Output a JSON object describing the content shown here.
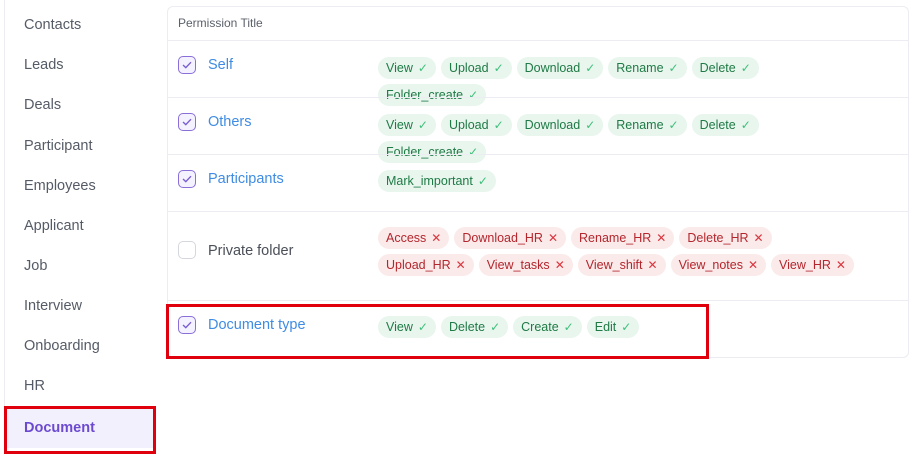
{
  "sidebar": {
    "items": [
      {
        "label": "Contacts"
      },
      {
        "label": "Leads"
      },
      {
        "label": "Deals"
      },
      {
        "label": "Participant"
      },
      {
        "label": "Employees"
      },
      {
        "label": "Applicant"
      },
      {
        "label": "Job"
      },
      {
        "label": "Interview"
      },
      {
        "label": "Onboarding"
      },
      {
        "label": "HR"
      },
      {
        "label": "Document"
      }
    ],
    "active": "Document"
  },
  "table": {
    "header": "Permission Title",
    "rows": [
      {
        "title": "Self",
        "checked": true,
        "chips": [
          {
            "label": "View",
            "granted": true
          },
          {
            "label": "Upload",
            "granted": true
          },
          {
            "label": "Download",
            "granted": true
          },
          {
            "label": "Rename",
            "granted": true
          },
          {
            "label": "Delete",
            "granted": true
          },
          {
            "label": "Folder_create",
            "granted": true
          }
        ]
      },
      {
        "title": "Others",
        "checked": true,
        "chips": [
          {
            "label": "View",
            "granted": true
          },
          {
            "label": "Upload",
            "granted": true
          },
          {
            "label": "Download",
            "granted": true
          },
          {
            "label": "Rename",
            "granted": true
          },
          {
            "label": "Delete",
            "granted": true
          },
          {
            "label": "Folder_create",
            "granted": true
          }
        ]
      },
      {
        "title": "Participants",
        "checked": true,
        "chips": [
          {
            "label": "Mark_important",
            "granted": true
          }
        ]
      },
      {
        "title": "Private folder",
        "checked": false,
        "chips": [
          {
            "label": "Access",
            "granted": false
          },
          {
            "label": "Download_HR",
            "granted": false
          },
          {
            "label": "Rename_HR",
            "granted": false
          },
          {
            "label": "Delete_HR",
            "granted": false
          },
          {
            "label": "Upload_HR",
            "granted": false
          },
          {
            "label": "View_tasks",
            "granted": false
          },
          {
            "label": "View_shift",
            "granted": false
          },
          {
            "label": "View_notes",
            "granted": false
          },
          {
            "label": "View_HR",
            "granted": false
          }
        ]
      },
      {
        "title": "Document type",
        "checked": true,
        "chips": [
          {
            "label": "View",
            "granted": true
          },
          {
            "label": "Delete",
            "granted": true
          },
          {
            "label": "Create",
            "granted": true
          },
          {
            "label": "Edit",
            "granted": true
          }
        ]
      }
    ]
  },
  "icons": {
    "granted": "check-icon",
    "denied": "cross-icon"
  },
  "colors": {
    "accent": "#6b4ad0",
    "link": "#3f8ce3",
    "granted_bg": "#e8f6ee",
    "denied_bg": "#fbeaea",
    "highlight": "#e0000d"
  }
}
